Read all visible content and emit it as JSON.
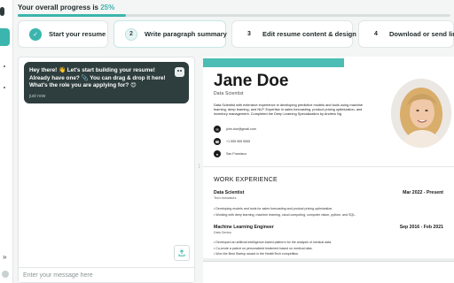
{
  "progress": {
    "label": "Your overall progress is",
    "value": "25%",
    "fraction": 0.25
  },
  "steps": [
    {
      "number": "✓",
      "label": "Start your resume",
      "state": "done"
    },
    {
      "number": "2",
      "label": "Write paragraph summary",
      "state": "current"
    },
    {
      "number": "3",
      "label": "Edit resume content & design",
      "state": "upcoming"
    },
    {
      "number": "4",
      "label": "Download or send link",
      "state": "upcoming"
    }
  ],
  "chat": {
    "message": "Hey there! 👋 Let's start building your resume! Already have one? 📎 You can drag & drop it here! What's the role you are applying for? 😊",
    "time": "just now",
    "input_placeholder": "Enter your message here"
  },
  "sidebar": {
    "expand_icon": "»"
  },
  "resume": {
    "name": "Jane Doe",
    "role": "Data Scientist",
    "summary": "Data Scientist with extensive experience in developing predictive models and tools using machine learning, deep learning, and NLP. Expertise in sales forecasting, product pricing optimization, and inventory management. Completed the Deep Learning Specialization by Andrew Ng",
    "email": "john.doe@gmail.com",
    "phone": "+1 555 555 5555",
    "location": "San Francisco",
    "section_title": "WORK EXPERIENCE",
    "jobs": [
      {
        "title": "Data Scientist",
        "company": "Tech Innovators",
        "dates": "Mar 2022 - Present",
        "bullets": [
          "Developing models and tools for sales forecasting and product pricing optimization.",
          "Working with deep learning, machine learning, cloud computing, computer vision, python, and SQL."
        ]
      },
      {
        "title": "Machine Learning Engineer",
        "company": "Data Genius",
        "dates": "Sep 2016 - Feb 2021",
        "bullets": [
          "Developed an artificial intelligence-based platform for the analysis of medical data.",
          "Co-wrote a patent on personalized treatment based on medical data.",
          "Won the Best Startup award in the HealthTech competition."
        ]
      }
    ]
  },
  "colors": {
    "accent": "#3bb5ad",
    "chat_bubble": "#2e3d3d",
    "resume_bar": "#4bbdb5"
  }
}
